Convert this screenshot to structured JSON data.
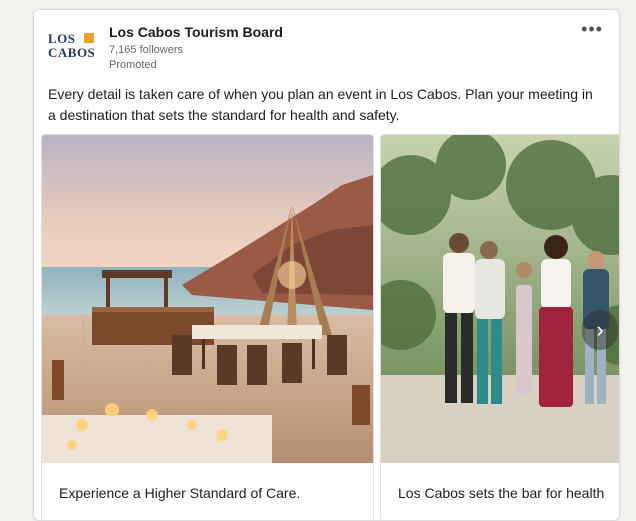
{
  "post": {
    "org_logo_line1": "LOS",
    "org_logo_line2": "CABOS",
    "org_name": "Los Cabos Tourism Board",
    "followers": "7,165 followers",
    "promoted": "Promoted",
    "more_icon": "more-horizontal-icon",
    "text": "Every detail is taken care of when you plan an event in Los Cabos. Plan your meeting in a destination that sets the standard for health and safety."
  },
  "carousel": {
    "slides": [
      {
        "image": "beach-event-dinner-setup",
        "caption": "Experience a Higher Standard of Care."
      },
      {
        "image": "group-walking-garden-path",
        "caption": "Los Cabos sets the bar for health"
      }
    ],
    "next_icon": "chevron-right-icon"
  },
  "colors": {
    "background": "#f3f2ef",
    "card": "#ffffff",
    "logo_accent": "#f0a02c"
  }
}
